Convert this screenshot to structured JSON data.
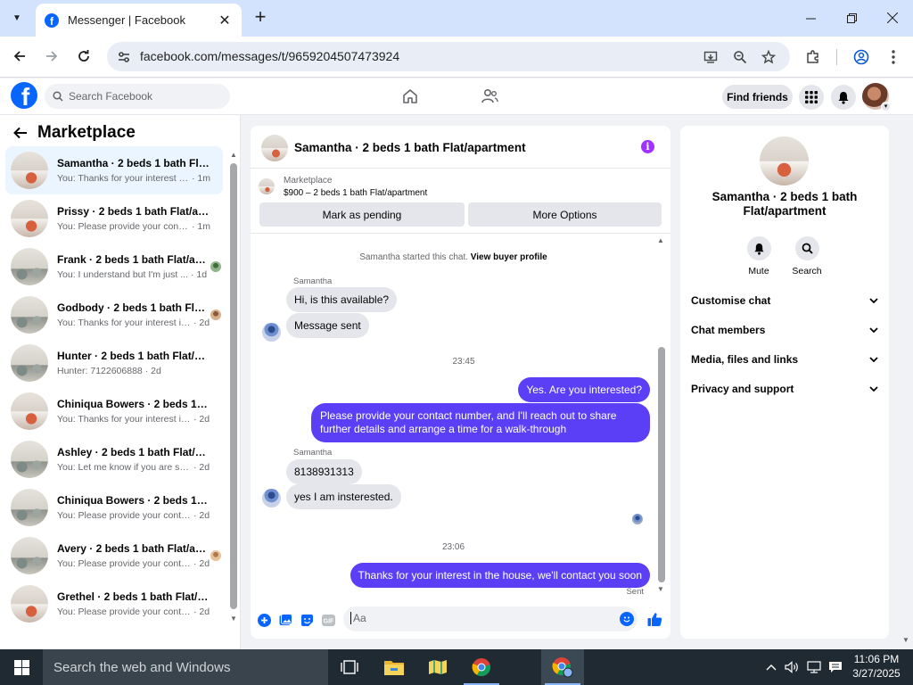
{
  "browser": {
    "tab_title": "Messenger | Facebook",
    "url": "facebook.com/messages/t/9659204507473924"
  },
  "fb": {
    "search_placeholder": "Search Facebook",
    "find_friends": "Find friends"
  },
  "sidebar": {
    "title": "Marketplace",
    "conversations": [
      {
        "name": "Samantha · 2 beds 1 bath Flat/a...",
        "preview": "You: Thanks for your interest in th...",
        "time": "· 1m",
        "active": true
      },
      {
        "name": "Prissy · 2 beds 1 bath Flat/apart...",
        "preview": "You: Please provide your contact ...",
        "time": "· 1m"
      },
      {
        "name": "Frank · 2 beds 1 bath Flat/apart...",
        "preview": "You: I understand but I'm just ...",
        "time": "· 1d"
      },
      {
        "name": "Godbody · 2 beds 1 bath Flat...",
        "preview": "You: Thanks for your interest in ...",
        "time": "· 2d"
      },
      {
        "name": "Hunter · 2 beds 1 bath Flat/apar...",
        "preview": "Hunter: 7122606888",
        "time": "· 2d"
      },
      {
        "name": "Chiniqua Bowers · 2 beds 1 bath...",
        "preview": "You: Thanks for your interest in th...",
        "time": "· 2d"
      },
      {
        "name": "Ashley · 2 beds 1 bath Flat/apar...",
        "preview": "You: Let me know if you are still in...",
        "time": "· 2d"
      },
      {
        "name": "Chiniqua Bowers · 2 beds 1 bath...",
        "preview": "You: Please provide your contact n...",
        "time": "· 2d"
      },
      {
        "name": "Avery · 2 beds 1 bath Flat/ap...",
        "preview": "You: Please provide your contac...",
        "time": "· 2d"
      },
      {
        "name": "Grethel · 2 beds 1 bath Flat/apa...",
        "preview": "You: Please provide your contact n...",
        "time": "· 2d"
      }
    ]
  },
  "chat": {
    "title": "Samantha · 2 beds 1 bath Flat/apartment",
    "listing_source": "Marketplace",
    "listing_price": "$900 – 2 beds 1 bath Flat/apartment",
    "btn_pending": "Mark as pending",
    "btn_more": "More Options",
    "system_text": "Samantha started this chat.",
    "system_link": "View buyer profile",
    "sender1": "Samantha",
    "msg1": "Hi, is this available?",
    "msg2": "Message sent",
    "time1": "23:45",
    "out1": "Yes. Are you interested?",
    "out2": "Please provide your contact number, and I'll reach out to share further details and arrange a time for a walk-through",
    "sender2": "Samantha",
    "msg3": "8138931313",
    "msg4": "yes I am insterested.",
    "time2": "23:06",
    "out3": "Thanks for your interest in the house, we'll contact you soon",
    "sent_label": "Sent",
    "composer_placeholder": "Aa"
  },
  "info_panel": {
    "name": "Samantha · 2 beds 1 bath Flat/apartment",
    "mute": "Mute",
    "search": "Search",
    "sections": [
      "Customise chat",
      "Chat members",
      "Media, files and links",
      "Privacy and support"
    ]
  },
  "taskbar": {
    "search_text": "Search the web and Windows",
    "time": "11:06 PM",
    "date": "3/27/2025"
  },
  "colors": {
    "outgoing_bubble": "#5b3ff6",
    "fb_blue": "#0866ff",
    "info_purple": "#a033ff"
  }
}
